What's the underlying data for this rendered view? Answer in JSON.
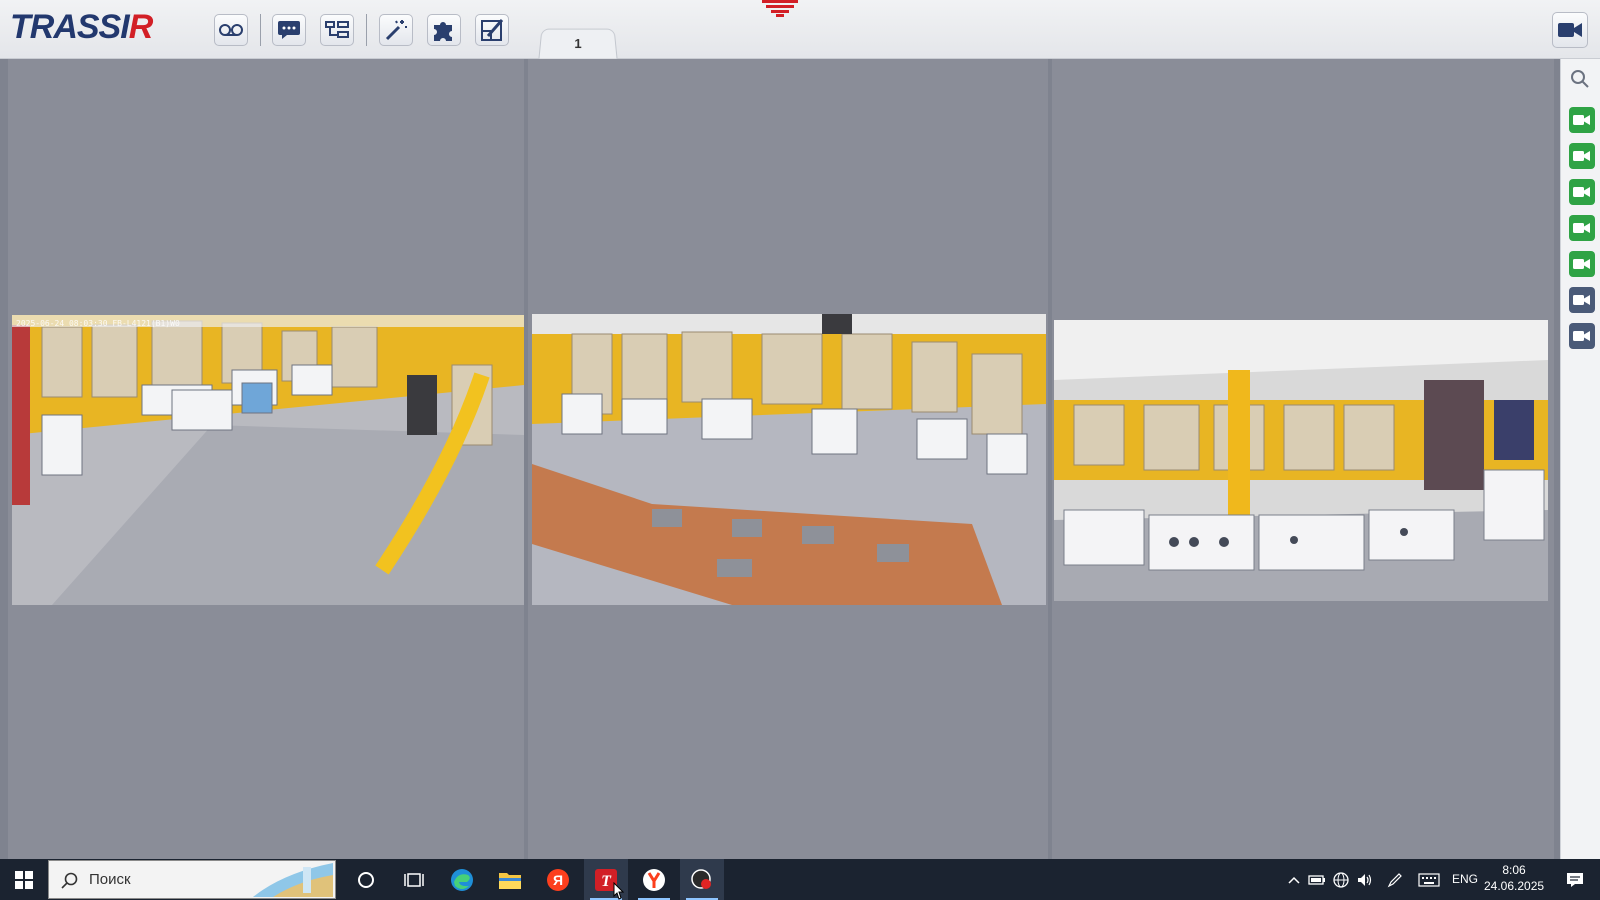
{
  "app": {
    "logo_main": "TRASSI",
    "logo_r": "R"
  },
  "toolbar": {
    "buttons": [
      "voicemail-icon",
      "chat-icon",
      "tree-icon",
      "magic-wand-icon",
      "puzzle-icon",
      "edit-screen-icon"
    ],
    "tab_label": "1"
  },
  "cameras": [
    {
      "osd": "2025-06-24 08:03:30  FB-L4121(B1)W0"
    },
    {
      "osd": ""
    },
    {
      "osd": ""
    }
  ],
  "side_panel": {
    "cameras": [
      {
        "state": "online",
        "color": "#2fa345"
      },
      {
        "state": "online",
        "color": "#2fa345"
      },
      {
        "state": "online",
        "color": "#2fa345"
      },
      {
        "state": "online",
        "color": "#2fa345"
      },
      {
        "state": "online",
        "color": "#2fa345"
      },
      {
        "state": "offline",
        "color": "#4a5a78"
      },
      {
        "state": "offline",
        "color": "#4a5a78"
      }
    ]
  },
  "taskbar": {
    "search_placeholder": "Поиск",
    "language": "ENG",
    "time": "8:06",
    "date": "24.06.2025",
    "apps": [
      "start-icon",
      "cortana-icon",
      "task-view-icon",
      "edge-icon",
      "explorer-icon",
      "yandex-icon",
      "trassir-icon",
      "yandex-browser-icon",
      "recorder-icon"
    ]
  },
  "colors": {
    "brand_blue": "#22386e",
    "brand_red": "#d21f26",
    "camera_online": "#2fa345",
    "camera_offline": "#4a5a78",
    "wall_yellow": "#e8b523"
  }
}
